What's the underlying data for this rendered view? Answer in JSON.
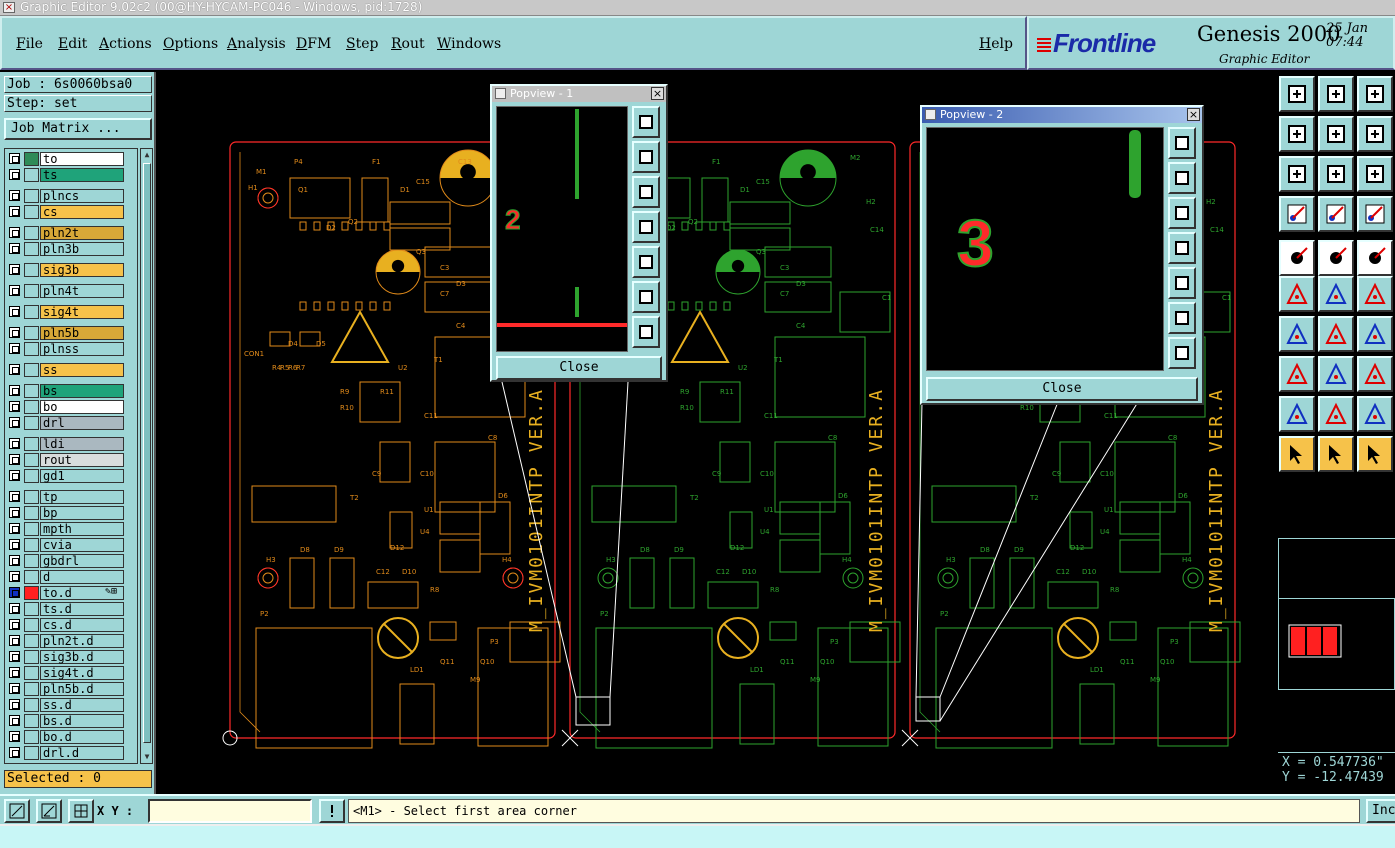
{
  "window": {
    "title": "Graphic Editor 9.02c2 (00@HY-HYCAM-PC046 - Windows, pid:1728)"
  },
  "menu": {
    "items": [
      "File",
      "Edit",
      "Actions",
      "Options",
      "Analysis",
      "DFM",
      "Step",
      "Rout",
      "Windows"
    ],
    "help": "Help"
  },
  "brand": {
    "logo": "Frontline",
    "product": "Genesis 2000",
    "subtitle": "Graphic Editor",
    "date": "25 Jan",
    "time": "07:44"
  },
  "panel": {
    "job": "Job : 6s0060bsa0",
    "step": "Step: set",
    "job_matrix": "Job Matrix ...",
    "selected": "Selected : 0"
  },
  "layers": [
    {
      "name": "to",
      "bg": "#ffffff",
      "swatch": "#2e8b57"
    },
    {
      "name": "ts",
      "bg": "#1fa37a",
      "swatch": "#9ed6d6"
    },
    {
      "name": "plncs",
      "bg": "#9ed6d6",
      "swatch": "#9ed6d6"
    },
    {
      "name": "cs",
      "bg": "#f6c24a",
      "swatch": "#9ed6d6"
    },
    {
      "name": "pln2t",
      "bg": "#d8a838",
      "swatch": "#9ed6d6"
    },
    {
      "name": "pln3b",
      "bg": "#9ed6d6",
      "swatch": "#9ed6d6"
    },
    {
      "name": "sig3b",
      "bg": "#f6c24a",
      "swatch": "#9ed6d6"
    },
    {
      "name": "pln4t",
      "bg": "#9ed6d6",
      "swatch": "#9ed6d6"
    },
    {
      "name": "sig4t",
      "bg": "#f6c24a",
      "swatch": "#9ed6d6"
    },
    {
      "name": "pln5b",
      "bg": "#d8a838",
      "swatch": "#9ed6d6"
    },
    {
      "name": "plnss",
      "bg": "#9ed6d6",
      "swatch": "#9ed6d6"
    },
    {
      "name": "ss",
      "bg": "#f6c24a",
      "swatch": "#9ed6d6"
    },
    {
      "name": "bs",
      "bg": "#1fa37a",
      "swatch": "#9ed6d6"
    },
    {
      "name": "bo",
      "bg": "#ffffff",
      "swatch": "#9ed6d6"
    },
    {
      "name": "drl",
      "bg": "#aab8c0",
      "swatch": "#9ed6d6"
    },
    {
      "name": "ldi",
      "bg": "#aab8c0",
      "swatch": "#9ed6d6"
    },
    {
      "name": "rout",
      "bg": "#d8dcdc",
      "swatch": "#9ed6d6"
    },
    {
      "name": "gd1",
      "bg": "#9ed6d6",
      "swatch": "#9ed6d6"
    },
    {
      "name": "tp",
      "bg": "#9ed6d6",
      "swatch": "#9ed6d6"
    },
    {
      "name": "bp",
      "bg": "#9ed6d6",
      "swatch": "#9ed6d6"
    },
    {
      "name": "mpth",
      "bg": "#9ed6d6",
      "swatch": "#9ed6d6"
    },
    {
      "name": "cvia",
      "bg": "#9ed6d6",
      "swatch": "#9ed6d6"
    },
    {
      "name": "gbdrl",
      "bg": "#9ed6d6",
      "swatch": "#9ed6d6"
    },
    {
      "name": "d",
      "bg": "#9ed6d6",
      "swatch": "#9ed6d6"
    },
    {
      "name": "to.d",
      "bg": "#9ed6d6",
      "swatch": "#ff2020",
      "active": true
    },
    {
      "name": "ts.d",
      "bg": "#9ed6d6",
      "swatch": "#9ed6d6"
    },
    {
      "name": "cs.d",
      "bg": "#9ed6d6",
      "swatch": "#9ed6d6"
    },
    {
      "name": "pln2t.d",
      "bg": "#9ed6d6",
      "swatch": "#9ed6d6"
    },
    {
      "name": "sig3b.d",
      "bg": "#9ed6d6",
      "swatch": "#9ed6d6"
    },
    {
      "name": "sig4t.d",
      "bg": "#9ed6d6",
      "swatch": "#9ed6d6"
    },
    {
      "name": "pln5b.d",
      "bg": "#9ed6d6",
      "swatch": "#9ed6d6"
    },
    {
      "name": "ss.d",
      "bg": "#9ed6d6",
      "swatch": "#9ed6d6"
    },
    {
      "name": "bs.d",
      "bg": "#9ed6d6",
      "swatch": "#9ed6d6"
    },
    {
      "name": "bo.d",
      "bg": "#9ed6d6",
      "swatch": "#9ed6d6"
    },
    {
      "name": "drl.d",
      "bg": "#9ed6d6",
      "swatch": "#9ed6d6"
    }
  ],
  "popview1": {
    "title": "Popview - 1",
    "close": "Close",
    "label": "2"
  },
  "popview2": {
    "title": "Popview - 2",
    "close": "Close",
    "label": "3"
  },
  "board": {
    "text_vertical": "M_IVM0101INTP VER.A",
    "refdes": [
      "M1",
      "P4",
      "F1",
      "C13",
      "M2",
      "H1",
      "Q1",
      "D1",
      "C15",
      "Q2",
      "D2",
      "Q3",
      "C3",
      "C7",
      "D3",
      "C4",
      "C14",
      "H2",
      "C1",
      "U2",
      "T1",
      "CON1",
      "D4",
      "D5",
      "R4",
      "R5",
      "R6",
      "R7",
      "R9",
      "R10",
      "R11",
      "C11",
      "C8",
      "C9",
      "C10",
      "T2",
      "D6",
      "U1",
      "U4",
      "D12",
      "H3",
      "D8",
      "D9",
      "C12",
      "H4",
      "D10",
      "R8",
      "P2",
      "Q11",
      "Q10",
      "P3",
      "LD1",
      "M9"
    ],
    "colors": {
      "outline": "#ff2a2a",
      "copper_orange": "#e08a1a",
      "copper_green": "#2ea32e",
      "silk_yellow": "#e8b020",
      "marker_white": "#ffffff"
    }
  },
  "coords": {
    "x": "X = 0.547736\"",
    "y": "Y = -12.47439"
  },
  "status": {
    "xy_label": "X Y :",
    "xy_value": "",
    "message": "<M1> - Select first area corner",
    "inc": "Inc"
  }
}
